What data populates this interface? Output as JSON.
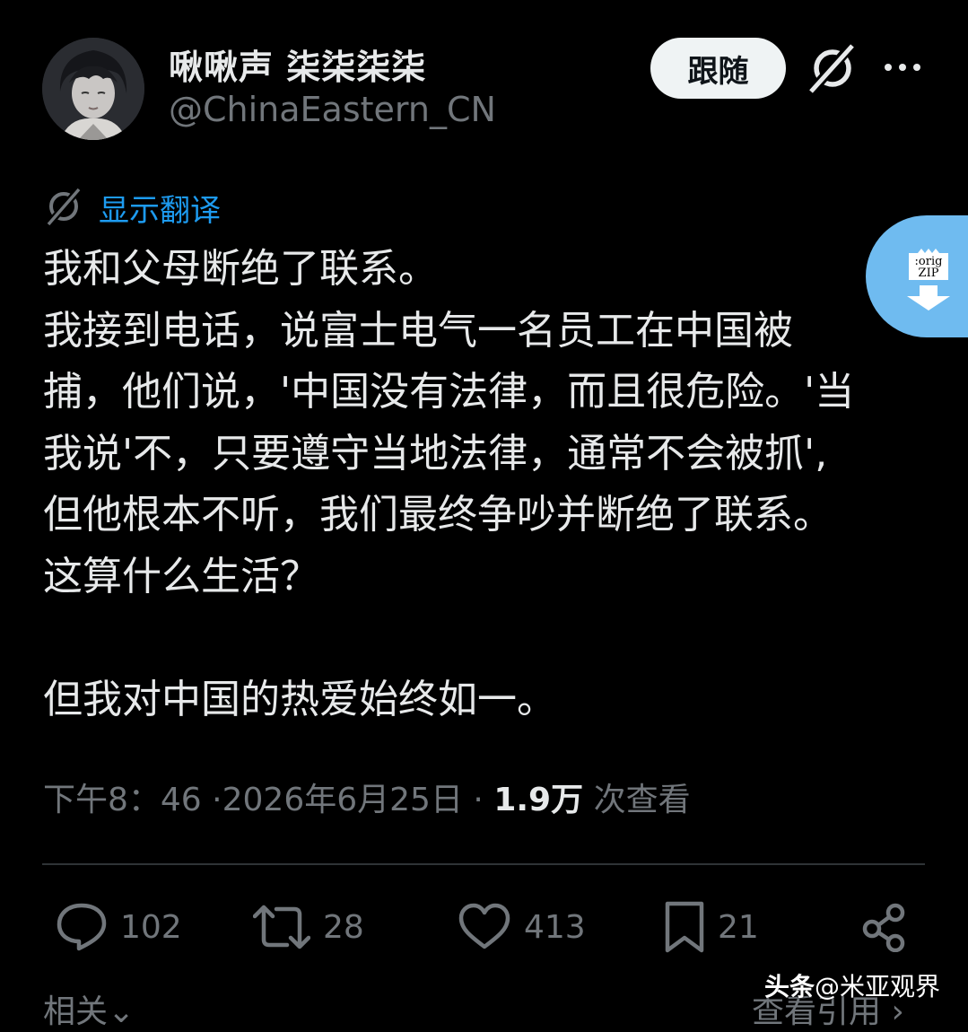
{
  "author": {
    "display_name": "啾啾声 柒柒柒柒",
    "handle": "@ChinaEastern_CN",
    "avatar_icon": "anime-character-avatar"
  },
  "header": {
    "follow_label": "跟随",
    "grok_icon": "grok-icon",
    "more_icon": "more-icon"
  },
  "translate": {
    "label": "显示翻译"
  },
  "zip_widget": {
    "line1": ":orig",
    "line2": "ZIP",
    "icon": "download-arrow-icon"
  },
  "tweet": {
    "lines": [
      "我和父母断绝了联系。",
      "我接到电话，说富士电气一名员工在中国被",
      "捕，他们说，'中国没有法律，而且很危险。'当",
      "我说'不，只要遵守当地法律，通常不会被抓',",
      "但他根本不听，我们最终争吵并断绝了联系。",
      "这算什么生活？",
      "",
      "但我对中国的热爱始终如一。"
    ]
  },
  "meta": {
    "time": "下午8：46",
    "date": "2026年6月25日",
    "views_count": "1.9万",
    "views_label": "次查看",
    "sep": "·"
  },
  "actions": {
    "replies": "102",
    "retweets": "28",
    "likes": "413",
    "bookmarks": "21"
  },
  "footer": {
    "related": "相关",
    "quotes": "查看引用",
    "watermark_brand": "头条",
    "watermark_handle": "@米亚观界"
  },
  "colors": {
    "background": "#000000",
    "text": "#e7e9ea",
    "muted": "#71767b",
    "link": "#1d9bf0",
    "divider": "#2f3336"
  }
}
